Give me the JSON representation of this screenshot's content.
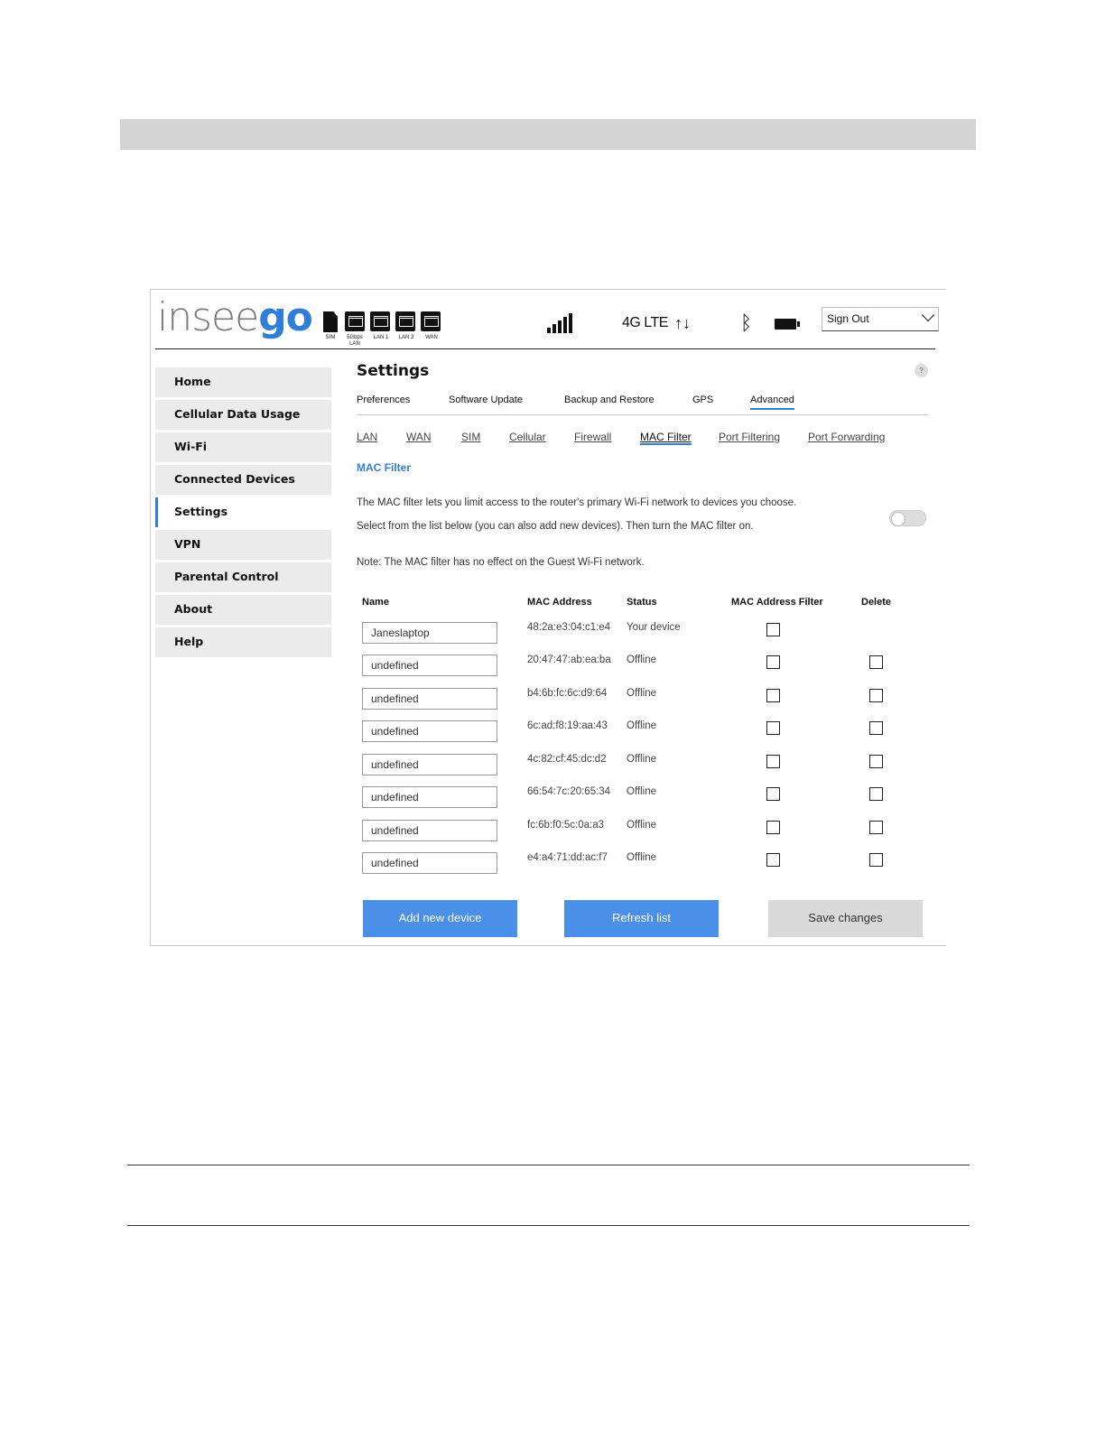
{
  "app": {
    "logo_left": "insee",
    "logo_right": "go"
  },
  "status_bar": {
    "ports": [
      "SIM",
      "5Gbps LAN",
      "LAN 1",
      "LAN 2",
      "WAN"
    ],
    "network": "4G LTE",
    "icons": [
      "sim-icon",
      "ethernet-port-icon",
      "signal-icon",
      "data-arrows-icon",
      "bluetooth-icon",
      "battery-icon"
    ],
    "signout": "Sign Out"
  },
  "sidebar": {
    "items": [
      {
        "label": "Home"
      },
      {
        "label": "Cellular Data Usage"
      },
      {
        "label": "Wi-Fi"
      },
      {
        "label": "Connected Devices"
      },
      {
        "label": "Settings"
      },
      {
        "label": "VPN"
      },
      {
        "label": "Parental Control"
      },
      {
        "label": "About"
      },
      {
        "label": "Help"
      }
    ],
    "active": "Settings"
  },
  "main": {
    "title": "Settings",
    "help": "?",
    "tabs": [
      "Preferences",
      "Software Update",
      "Backup and Restore",
      "GPS",
      "Advanced"
    ],
    "active_tab": "Advanced",
    "subtabs": [
      "LAN",
      "WAN",
      "SIM",
      "Cellular",
      "Firewall",
      "MAC Filter",
      "Port Filtering",
      "Port Forwarding"
    ],
    "active_subtab": "MAC Filter",
    "section_title": "MAC Filter",
    "description_1": "The MAC filter lets you limit access to the router's primary Wi-Fi network to devices you choose.",
    "description_2": "Select from the list below (you can also add new devices). Then turn the MAC filter on.",
    "note": "Note: The MAC filter has no effect on the Guest Wi-Fi network.",
    "mac_filter_enabled": false,
    "table": {
      "headers": [
        "Name",
        "MAC Address",
        "Status",
        "MAC Address Filter",
        "Delete"
      ],
      "rows": [
        {
          "name": "Janeslaptop",
          "mac": "48:2a:e3:04:c1:e4",
          "status": "Your device"
        },
        {
          "name": "undefined",
          "mac": "20:47:47:ab:ea:ba",
          "status": "Offline"
        },
        {
          "name": "undefined",
          "mac": "b4:6b:fc:6c:d9:64",
          "status": "Offline"
        },
        {
          "name": "undefined",
          "mac": "6c:ad:f8:19:aa:43",
          "status": "Offline"
        },
        {
          "name": "undefined",
          "mac": "4c:82:cf:45:dc:d2",
          "status": "Offline"
        },
        {
          "name": "undefined",
          "mac": "66:54:7c:20:65:34",
          "status": "Offline"
        },
        {
          "name": "undefined",
          "mac": "fc:6b:f0:5c:0a:a3",
          "status": "Offline"
        },
        {
          "name": "undefined",
          "mac": "e4:a4:71:dd:ac:f7",
          "status": "Offline"
        }
      ]
    },
    "buttons": {
      "add": "Add new device",
      "refresh": "Refresh list",
      "save": "Save changes"
    }
  },
  "colors": {
    "accent": "#2f7ed8",
    "button_blue": "#4a90e8",
    "button_gray": "#d9d9d9"
  }
}
